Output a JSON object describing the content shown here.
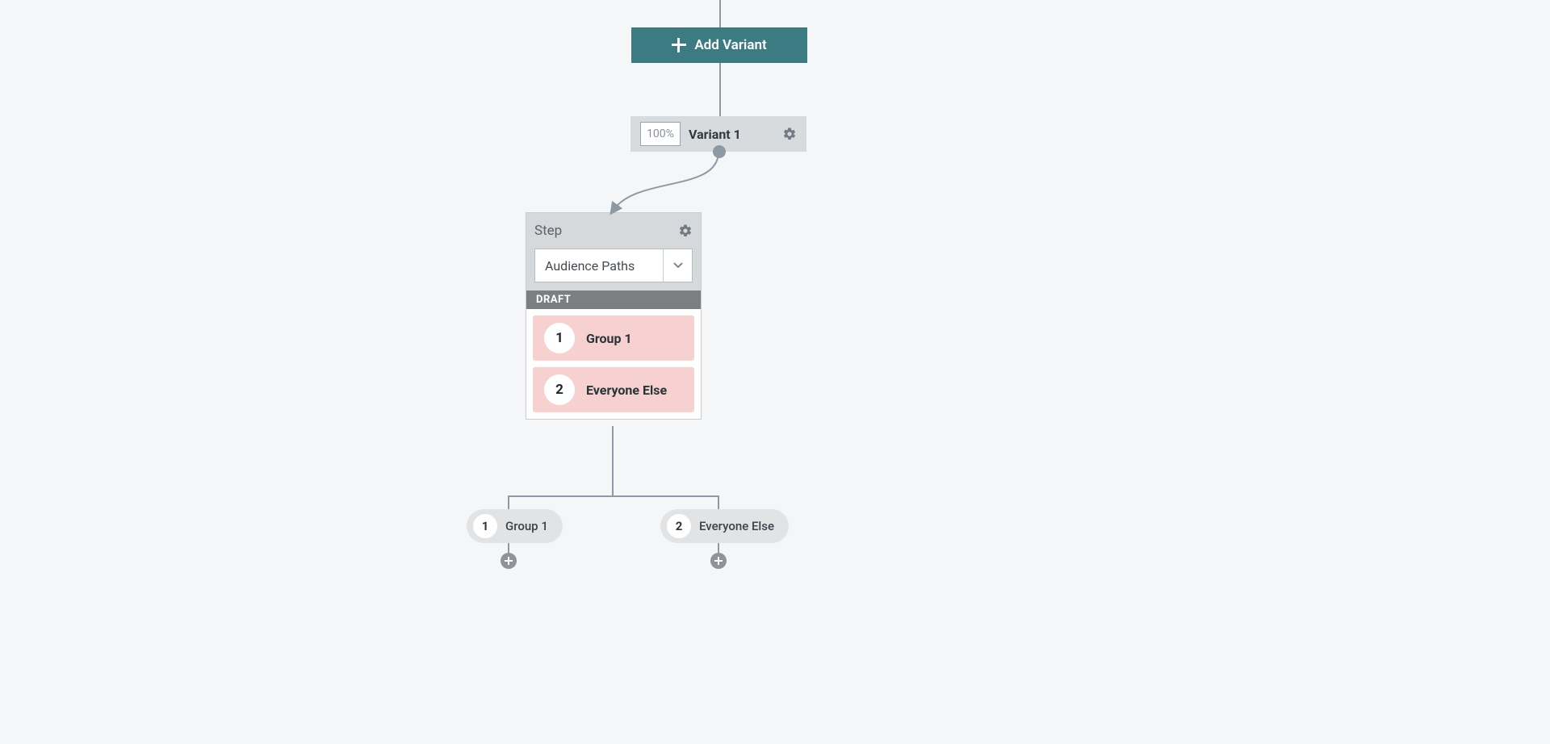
{
  "addVariant": {
    "label": "Add Variant"
  },
  "variant": {
    "percentage": "100%",
    "name": "Variant 1"
  },
  "step": {
    "title": "Step",
    "selected": "Audience Paths",
    "status": "DRAFT",
    "groups": [
      {
        "num": "1",
        "label": "Group 1"
      },
      {
        "num": "2",
        "label": "Everyone Else"
      }
    ]
  },
  "branches": [
    {
      "num": "1",
      "label": "Group 1"
    },
    {
      "num": "2",
      "label": "Everyone Else"
    }
  ]
}
